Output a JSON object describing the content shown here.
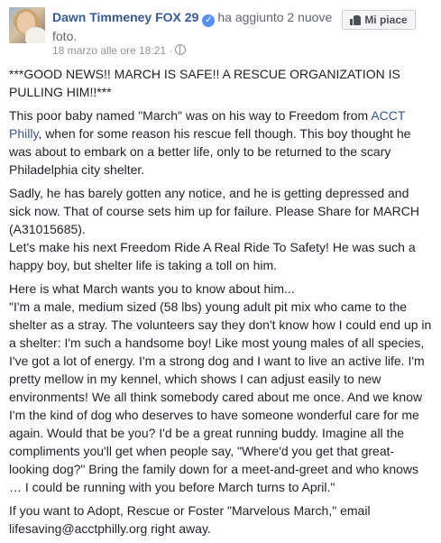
{
  "post": {
    "author": "Dawn Timmeney FOX 29",
    "action": "ha aggiunto 2 nuove foto.",
    "timestamp": "18 marzo alle ore 18:21 ·",
    "like_label": "Mi piace",
    "paragraphs": {
      "p1": "***GOOD NEWS!! MARCH IS SAFE!! A RESCUE ORGANIZATION IS PULLING HIM!!***",
      "p2_before": "This poor baby named \"March\" was on his way to Freedom from ",
      "p2_link": "ACCT Philly",
      "p2_after": ", when for some reason his rescue fell though. This boy thought he was about to embark on a better life, only to be returned to the scary Philadelphia city shelter.",
      "p3": "Sadly, he has barely gotten any notice, and he is getting depressed and sick now. That of course sets him up for failure. Please Share for MARCH (A31015685).",
      "p4": "Let's make his next Freedom Ride A Real Ride To Safety! He was such a happy boy, but shelter life is taking a toll on him.",
      "p5": "Here is what March wants you to know about him...",
      "p6": "\"I'm a male, medium sized (58 lbs) young adult pit mix who came to the shelter as a stray. The volunteers say they don't know how I could end up in a shelter: I'm such a handsome boy! Like most young males of all species, I've got a lot of energy. I'm a strong dog and I want to live an active life. I'm pretty mellow in my kennel, which shows I can adjust easily to new environments! We all think somebody cared about me once. And we know I'm the kind of dog who deserves to have someone wonderful care for me again. Would that be you? I'd be a great running buddy. Imagine all the compliments you'll get when people say, \"Where'd you get that great-looking dog?\" Bring the family down for a meet-and-greet and who knows … I could be running with you before March turns to April.\"",
      "p7": "If you want to Adopt, Rescue or Foster \"Marvelous March,\" email lifesaving@acctphilly.org right away."
    }
  },
  "icons": {
    "verified": "verified-badge-icon",
    "privacy": "globe-icon",
    "like": "thumbs-up-icon"
  },
  "colors": {
    "link": "#365899",
    "verified": "#5890ff",
    "text": "#1d2129",
    "meta": "#90949c"
  }
}
